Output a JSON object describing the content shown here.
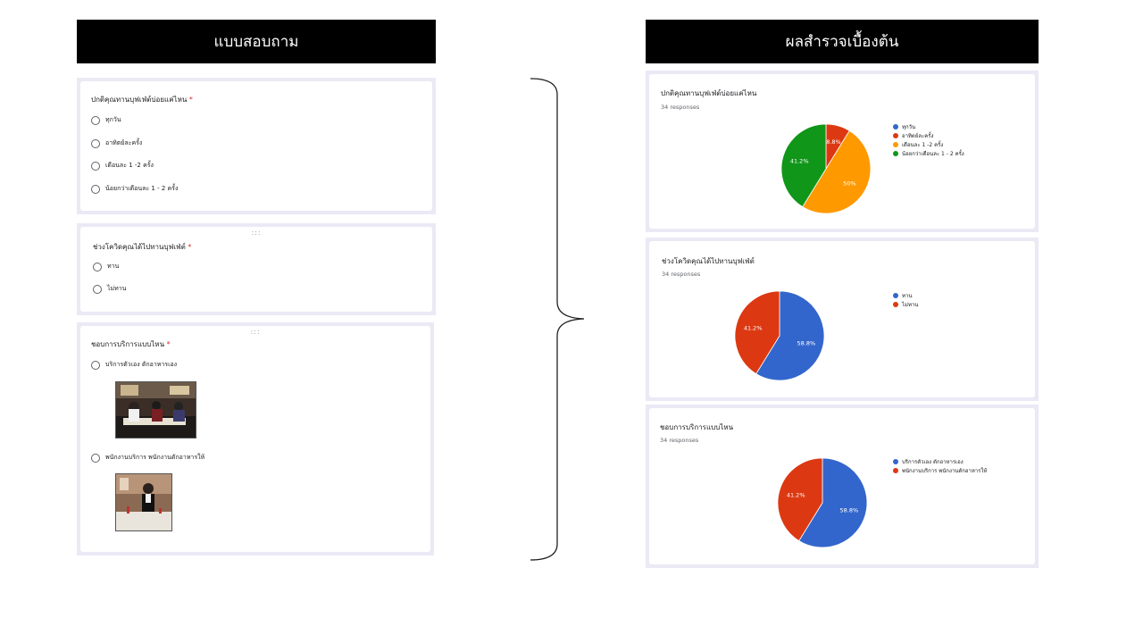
{
  "headers": {
    "form": "แบบสอบถาม",
    "results": "ผลสำรวจเบื้องต้น"
  },
  "form": {
    "q1": {
      "title": "ปกติคุณทานบุฟเฟ่ต์บ่อยแค่ไหน",
      "required": "*",
      "options": [
        "ทุกวัน",
        "อาทิตย์ละครั้ง",
        "เดือนละ 1 -2 ครั้ง",
        "น้อยกว่าเดือนละ 1 - 2 ครั้ง"
      ]
    },
    "q2": {
      "title": "ช่วงโควิดคุณได้ไปทานบุฟเฟ่ต์",
      "required": "*",
      "options": [
        "ทาน",
        "ไม่ทาน"
      ]
    },
    "q3": {
      "title": "ชอบการบริการแบบไหน",
      "required": "*",
      "options": [
        "บริการตัวเอง ตักอาหารเอง",
        "พนักงานบริการ พนักงานตักอาหารให้"
      ]
    }
  },
  "results": {
    "r1": {
      "title": "ปกติคุณทานบุฟเฟ่ต์บ่อยแค่ไหน",
      "responses": "34 responses"
    },
    "r2": {
      "title": "ช่วงโควิดคุณได้ไปทานบุฟเฟ่ต์",
      "responses": "34 responses"
    },
    "r3": {
      "title": "ชอบการบริการแบบไหน",
      "responses": "34 responses"
    }
  },
  "chart_data": [
    {
      "type": "pie",
      "categories": [
        "ทุกวัน",
        "อาทิตย์ละครั้ง",
        "เดือนละ 1 -2 ครั้ง",
        "น้อยกว่าเดือนละ 1 - 2 ครั้ง"
      ],
      "values": [
        0,
        8.8,
        50,
        41.2
      ],
      "labels": [
        "",
        "8.8%",
        "50%",
        "41.2%"
      ],
      "colors": [
        "#3366cc",
        "#dc3912",
        "#ff9900",
        "#109618"
      ],
      "legend": "right"
    },
    {
      "type": "pie",
      "categories": [
        "ทาน",
        "ไม่ทาน"
      ],
      "values": [
        58.8,
        41.2
      ],
      "labels": [
        "58.8%",
        "41.2%"
      ],
      "colors": [
        "#3366cc",
        "#dc3912"
      ],
      "legend": "right"
    },
    {
      "type": "pie",
      "categories": [
        "บริการตัวเอง ตักอาหารเอง",
        "พนักงานบริการ พนักงานตักอาหารให้"
      ],
      "values": [
        58.8,
        41.2
      ],
      "labels": [
        "58.8%",
        "41.2%"
      ],
      "colors": [
        "#3366cc",
        "#dc3912"
      ],
      "legend": "right"
    }
  ]
}
